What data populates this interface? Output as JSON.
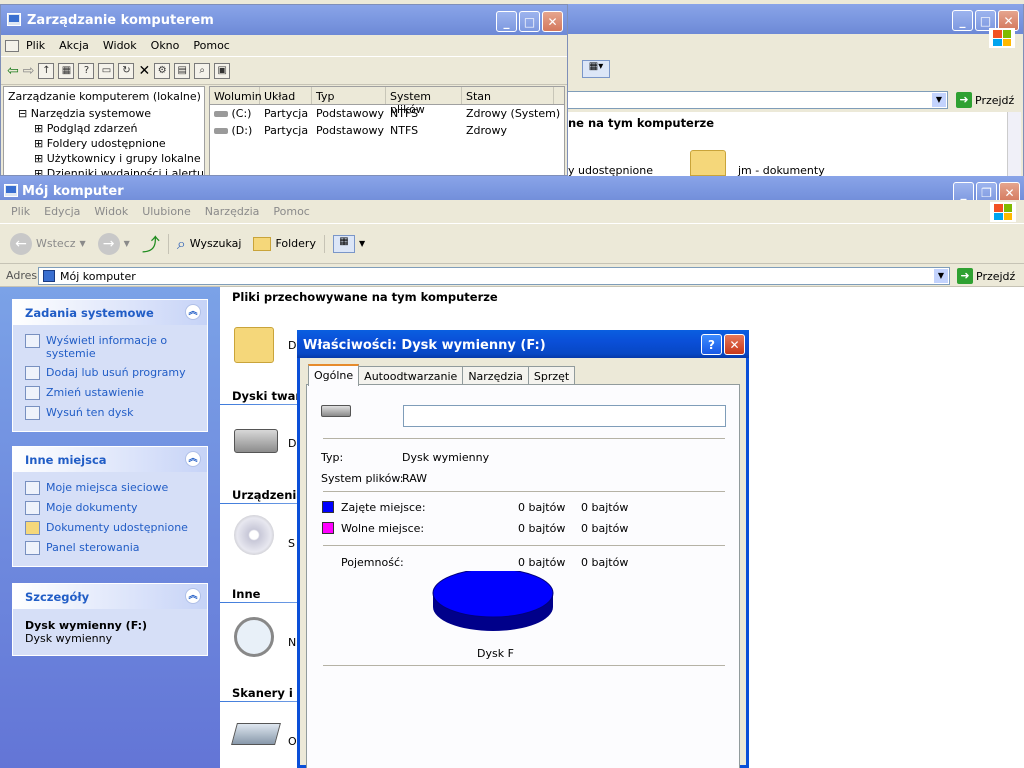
{
  "back_window": {
    "title": "Zarządzanie komputerem",
    "menu": [
      "Plik",
      "Akcja",
      "Widok",
      "Okno",
      "Pomoc"
    ],
    "tree": {
      "root": "Zarządzanie komputerem (lokalne)",
      "group": "Narzędzia systemowe",
      "items": [
        "Podgląd zdarzeń",
        "Foldery udostępnione",
        "Użytkownicy i grupy lokalne",
        "Dzienniki wydajności i alertu"
      ]
    },
    "columns": [
      "Wolumin",
      "Układ",
      "Typ",
      "System plików",
      "Stan"
    ],
    "volumes": [
      {
        "volume": "(C:)",
        "layout": "Partycja",
        "type": "Podstawowy",
        "fs": "NTFS",
        "status": "Zdrowy (System)"
      },
      {
        "volume": "(D:)",
        "layout": "Partycja",
        "type": "Podstawowy",
        "fs": "NTFS",
        "status": "Zdrowy"
      }
    ]
  },
  "middle_window": {
    "go_label": "Przejdź",
    "heading_fragment": "ne na tym komputerze",
    "item_fragment": "y udostępnione",
    "folder_label": "jm - dokumenty"
  },
  "main_window": {
    "title": "Mój komputer",
    "menu": [
      "Plik",
      "Edycja",
      "Widok",
      "Ulubione",
      "Narzędzia",
      "Pomoc"
    ],
    "toolbar": {
      "back": "Wstecz",
      "search": "Wyszukaj",
      "folders": "Foldery"
    },
    "address": {
      "label": "Adres",
      "value": "Mój komputer",
      "go": "Przejdź"
    },
    "sidebar": {
      "system_tasks": {
        "title": "Zadania systemowe",
        "links": [
          "Wyświetl informacje o systemie",
          "Dodaj lub usuń programy",
          "Zmień ustawienie",
          "Wysuń ten dysk"
        ]
      },
      "other_places": {
        "title": "Inne miejsca",
        "links": [
          "Moje miejsca sieciowe",
          "Moje dokumenty",
          "Dokumenty udostępnione",
          "Panel sterowania"
        ]
      },
      "details": {
        "title": "Szczegóły",
        "name": "Dysk wymienny (F:)",
        "desc": "Dysk wymienny"
      }
    },
    "content": {
      "sections": [
        "Pliki przechowywane na tym komputerze",
        "Dyski twarde",
        "Urządzenia",
        "Inne",
        "Skanery i a"
      ],
      "item_letters": [
        "D",
        "D",
        "S",
        "N",
        "O"
      ]
    }
  },
  "dialog": {
    "title": "Właściwości: Dysk wymienny (F:)",
    "tabs": [
      "Ogólne",
      "Autoodtwarzanie",
      "Narzędzia",
      "Sprzęt"
    ],
    "name_value": "",
    "type_label": "Typ:",
    "type_value": "Dysk wymienny",
    "fs_label": "System plików:",
    "fs_value": "RAW",
    "used_label": "Zajęte miejsce:",
    "used_bytes": "0 bajtów",
    "used_size": "0 bajtów",
    "free_label": "Wolne miejsce:",
    "free_bytes": "0 bajtów",
    "free_size": "0 bajtów",
    "capacity_label": "Pojemność:",
    "capacity_bytes": "0 bajtów",
    "capacity_size": "0 bajtów",
    "disk_label": "Dysk F",
    "colors": {
      "used": "#0000ff",
      "free": "#ff00ff"
    }
  }
}
